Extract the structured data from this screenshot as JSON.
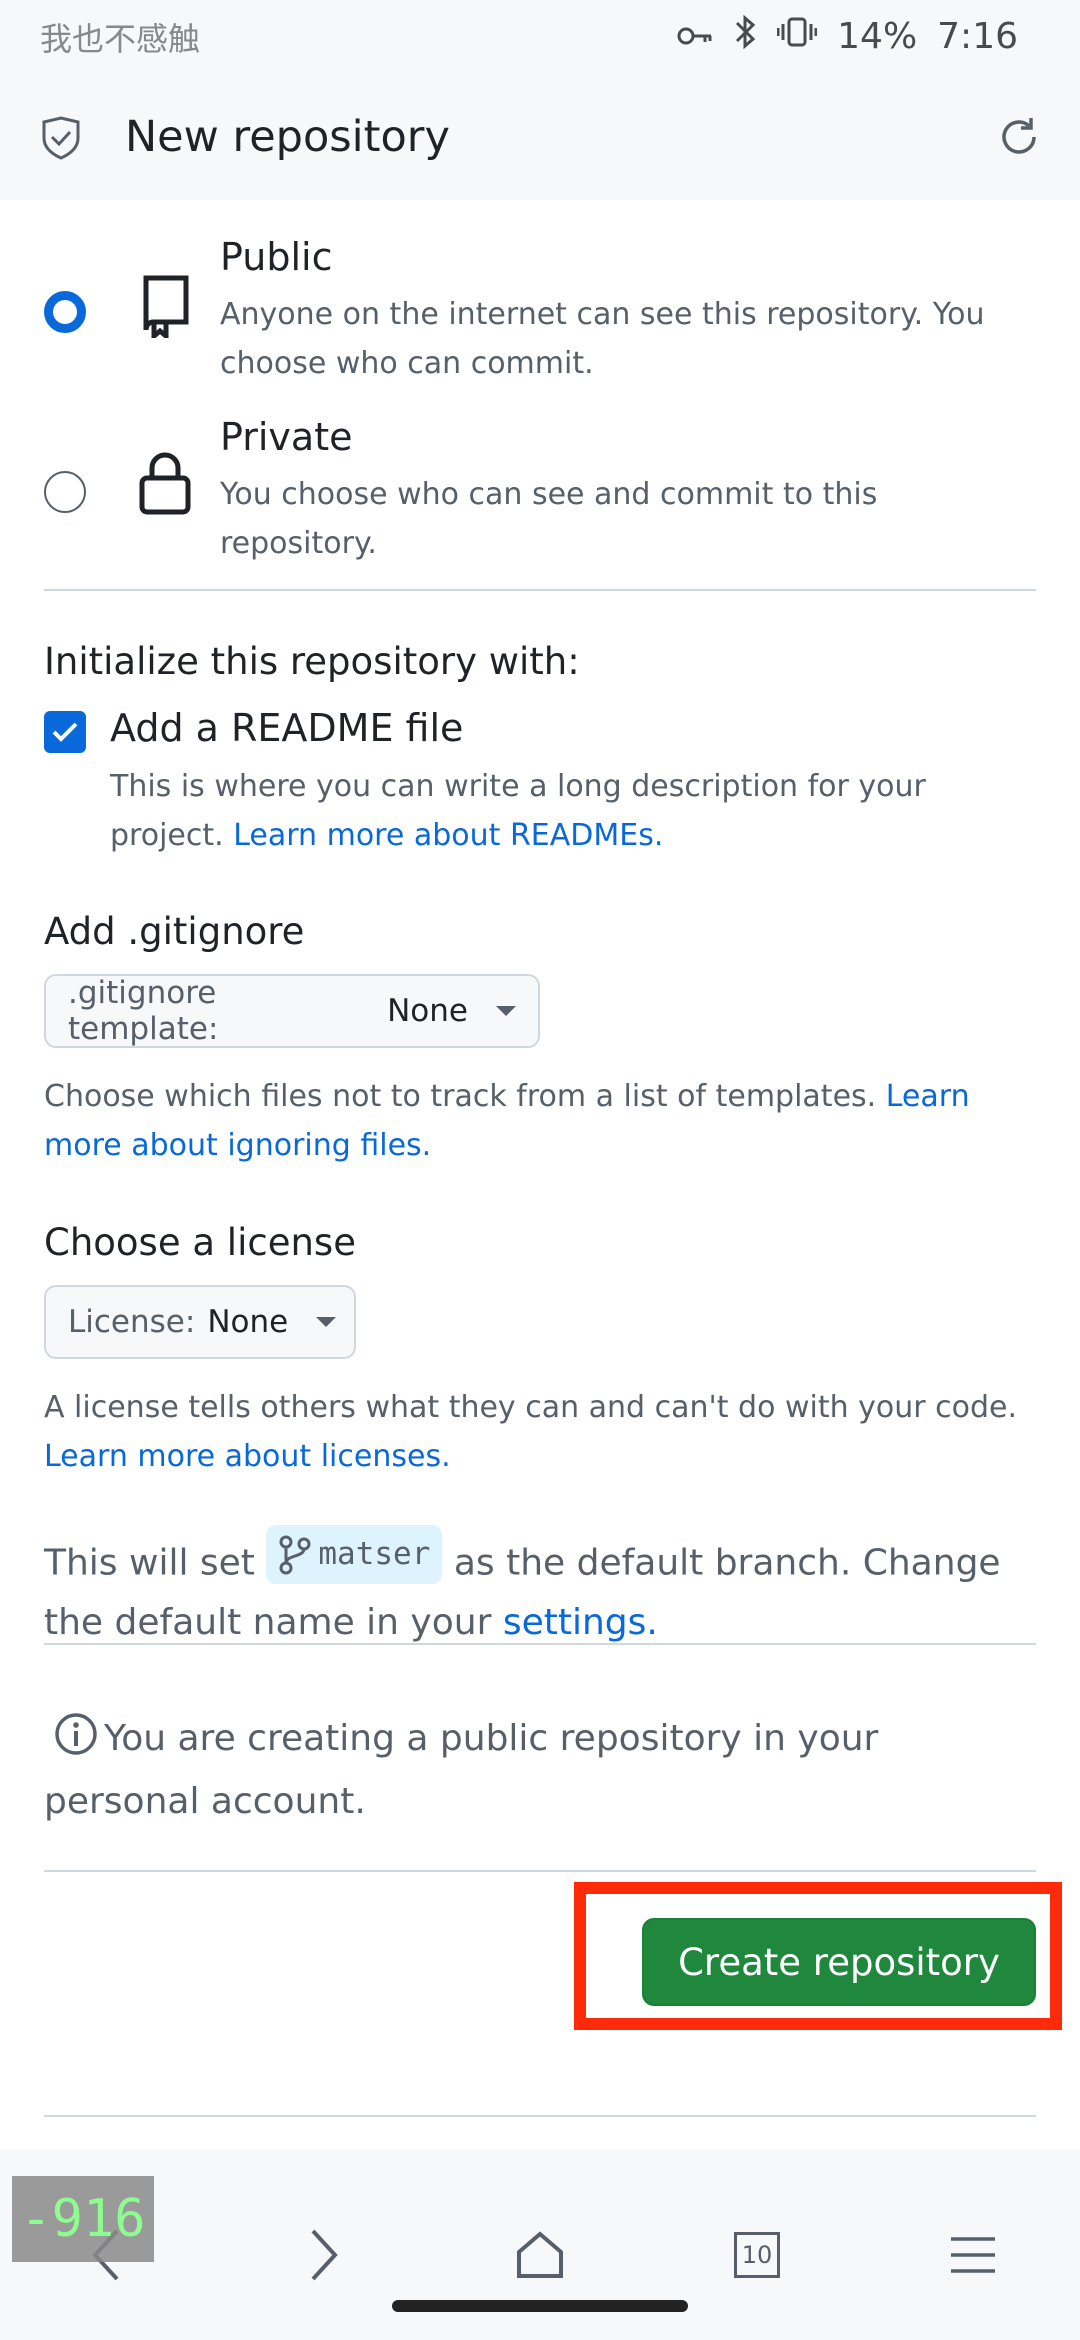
{
  "status_bar": {
    "left_text": "我也不感触",
    "battery": "14%",
    "time": "7:16"
  },
  "app_bar": {
    "title": "New repository"
  },
  "visibility": {
    "public": {
      "title": "Public",
      "description": "Anyone on the internet can see this repository. You choose who can commit.",
      "selected": true
    },
    "private": {
      "title": "Private",
      "description": "You choose who can see and commit to this repository.",
      "selected": false
    }
  },
  "initialize": {
    "heading": "Initialize this repository with:",
    "readme_label": "Add a README file",
    "readme_checked": true,
    "readme_desc": "This is where you can write a long description for your project.",
    "readme_link": "Learn more about READMEs."
  },
  "gitignore": {
    "heading": "Add .gitignore",
    "select_label": ".gitignore template:",
    "select_value": "None",
    "desc": "Choose which files not to track from a list of templates.",
    "link": "Learn more about ignoring files."
  },
  "license": {
    "heading": "Choose a license",
    "select_label": "License:",
    "select_value": "None",
    "desc": "A license tells others what they can and can't do with your code.",
    "link": "Learn more about licenses."
  },
  "branch": {
    "prefix": "This will set",
    "branch_name": "matser",
    "suffix": "as the default branch. Change the default name in your",
    "link": "settings."
  },
  "info": {
    "text": "You are creating a public repository in your personal account."
  },
  "create_button": {
    "label": "Create repository"
  },
  "bottom_nav": {
    "tab_count": "10",
    "overlay_counter": "-916"
  },
  "colors": {
    "accent": "#0969da",
    "create_green": "#1f883d",
    "highlight_red": "#ff2a0a"
  }
}
